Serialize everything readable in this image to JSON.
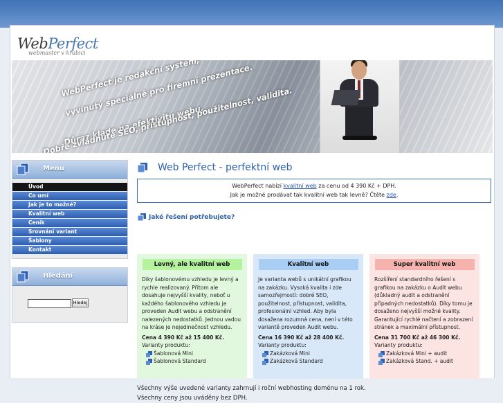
{
  "logo": {
    "brand_part1": "Web",
    "brand_part2": "Perfect",
    "tagline": "webmaster v krabici"
  },
  "banner": {
    "slogan": [
      "WebPerfect je redakční systém,",
      "vyvinutý speciálně pro firemní prezentace.",
      "Důraz klade na efektivitu webu.",
      "Dobře zvládnuté SEO, přístupnost, použitelnost, validita."
    ]
  },
  "sidebar": {
    "menu_title": "Menu",
    "menu_items": [
      {
        "label": "Úvod",
        "active": true
      },
      {
        "label": "Co umí"
      },
      {
        "label": "Jak je to možné?"
      },
      {
        "label": "Kvalitní web"
      },
      {
        "label": "Ceník"
      },
      {
        "label": "Srovnání variant"
      },
      {
        "label": "Šablony"
      },
      {
        "label": "Kontakt"
      }
    ],
    "search_title": "Hledání",
    "search_value": "",
    "search_button": "Hledej"
  },
  "main": {
    "title": "Web Perfect - perfektní web",
    "info_line1_pre": "WebPerfect nabízí ",
    "info_line1_link": "kvalitní web",
    "info_line1_post": " za cenu od 4 390 Kč + DPH.",
    "info_line2_pre": "Jak je možné prodávat tak kvalitní web tak levně? Čtěte ",
    "info_line2_link": "zde",
    "info_line2_post": ".",
    "subheading": "Jaké řešení potřebujete?",
    "columns": [
      {
        "title": "Levný, ale kvalitní web",
        "text": "Díky šablonovému vzhledu je levný a rychle realizovaný. Přitom ale dosahuje nejvyšší kvality, neboť u každého šablonového vzhledu je proveden Audit webu a odstranění nalezených nedostatků. Jednou vadou na kráse je nejedinečnost vzhledu.",
        "price": "Cena 4 390 Kč až 15 400 Kč.",
        "variants_label": "Varianty produktu:",
        "variants": [
          "Šablonová Mini",
          "Šablonová Standard"
        ]
      },
      {
        "title": "Kvalitní web",
        "text": "Je varianta webů s unikátní grafikou na zakázku. Vysoká kvalita i zde samozřejmostí: dobré SEO, použitelnost, přístupnost, validita, profesionální vzhled. Aby byla dosažena rozumná cena, není v této variantě proveden Audit webu.",
        "price": "Cena 16 390 Kč až 28 400 Kč.",
        "variants_label": "Varianty produktu:",
        "variants": [
          "Zakázková Mini",
          "Zakázková Standard"
        ]
      },
      {
        "title": "Super kvalitní web",
        "text": "Rozšíření standardního řešení s grafikou na zakázku o Audit webu (důkladný audit a odstranění případných nedostatků). Díky tomu je dosaženo nejvyšší možné kvality. Garantující rychlé načtení a zobrazení stránek a maximální přístupnost.",
        "price": "Cena 31 700 Kč až 46 300 Kč.",
        "variants_label": "Varianty produktu:",
        "variants": [
          "Zakázková Mini + audit",
          "Zakázková Stand. + audit"
        ]
      }
    ],
    "footer_line1": "Všechny výše uvedené varianty zahrnují i roční webhosting doménu na 1 rok.",
    "footer_line2": "Všechny ceny jsou uváděny bez DPH."
  },
  "colors": {
    "accent": "#2f60a8",
    "menu_item": "#3a6bc0",
    "menu_active": "#151515",
    "col_green": "#e1f8de",
    "col_blue": "#d8e8f8",
    "col_red": "#fbe4e2"
  },
  "icons": [
    "page-icon",
    "web-icon",
    "bullet-icon"
  ]
}
